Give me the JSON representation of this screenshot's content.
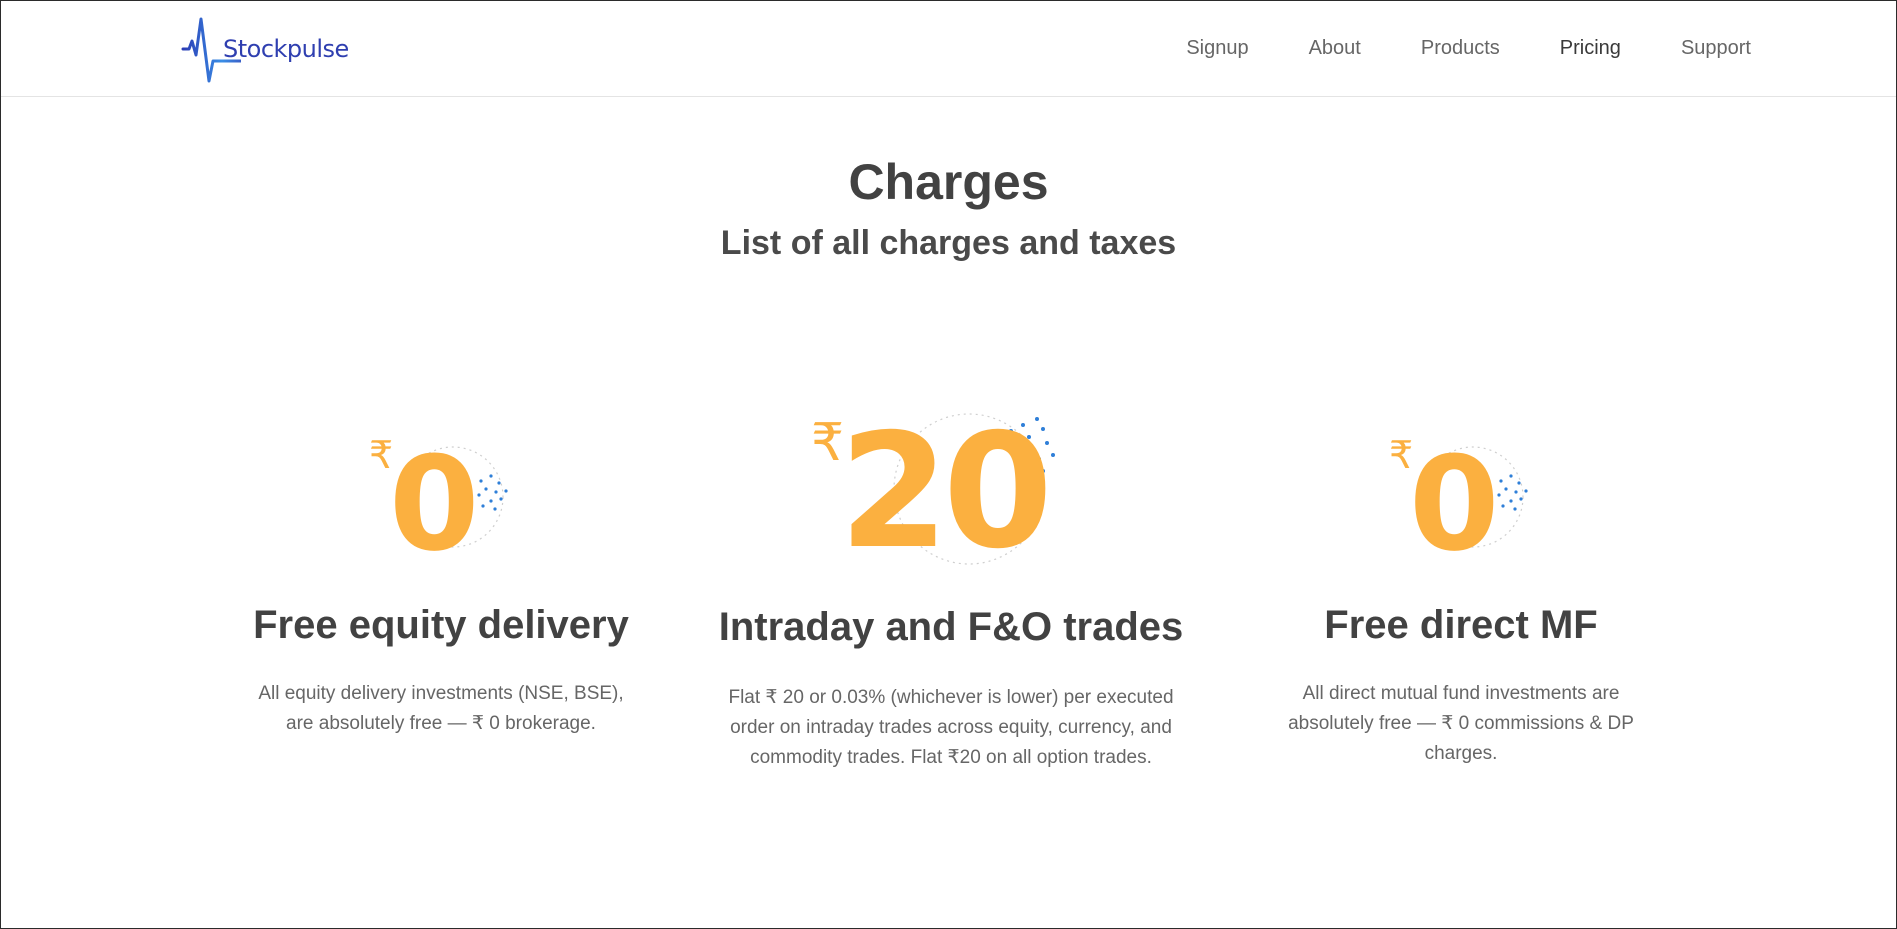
{
  "brand": {
    "name": "Stockpulse",
    "color": "#2f3fb0"
  },
  "nav": {
    "items": [
      "Signup",
      "About",
      "Products",
      "Pricing",
      "Support"
    ],
    "active": "Pricing"
  },
  "hero": {
    "title": "Charges",
    "subtitle": "List of all charges and taxes"
  },
  "colors": {
    "accent": "#fbb040",
    "dots": "#2f7fd8",
    "text": "#424242"
  },
  "cards": [
    {
      "currency": "₹",
      "price": "0",
      "title": "Free equity delivery",
      "description": "All equity delivery investments (NSE, BSE), are absolutely free — ₹ 0 brokerage."
    },
    {
      "currency": "₹",
      "price": "20",
      "title": "Intraday and F&O trades",
      "description": "Flat ₹ 20 or 0.03% (whichever is lower) per executed order on intraday trades across equity, currency, and commodity trades. Flat ₹20 on all option trades."
    },
    {
      "currency": "₹",
      "price": "0",
      "title": "Free direct MF",
      "description": "All direct mutual fund investments are absolutely free — ₹ 0 commissions & DP charges."
    }
  ]
}
